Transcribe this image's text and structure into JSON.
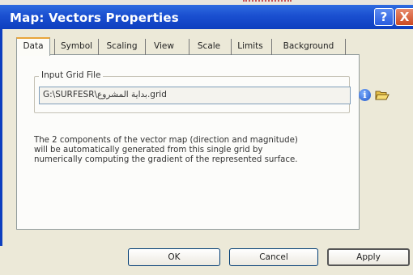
{
  "window": {
    "title": "Map: Vectors Properties",
    "help_label": "?",
    "close_label": "X"
  },
  "tabs": [
    {
      "label": "Data",
      "active": true
    },
    {
      "label": "Symbol",
      "active": false
    },
    {
      "label": "Scaling",
      "active": false
    },
    {
      "label": "View",
      "active": false
    },
    {
      "label": "Scale",
      "active": false
    },
    {
      "label": "Limits",
      "active": false
    },
    {
      "label": "Background",
      "active": false
    }
  ],
  "data_tab": {
    "group_label": "Input Grid File",
    "grid_file_value": "G:\\SURFESR\\بداية المشروع.grid",
    "info_icon": "info-icon",
    "open_icon": "open-folder-icon",
    "description": "The 2 components of the vector map (direction and magnitude) will be automatically generated from this single grid by numerically computing the gradient of the represented surface."
  },
  "buttons": {
    "ok": "OK",
    "cancel": "Cancel",
    "apply": "Apply"
  },
  "colors": {
    "titlebar": "#1a4fd0",
    "dialog_bg": "#ece9d8",
    "active_tab_accent": "#e8a53a"
  }
}
